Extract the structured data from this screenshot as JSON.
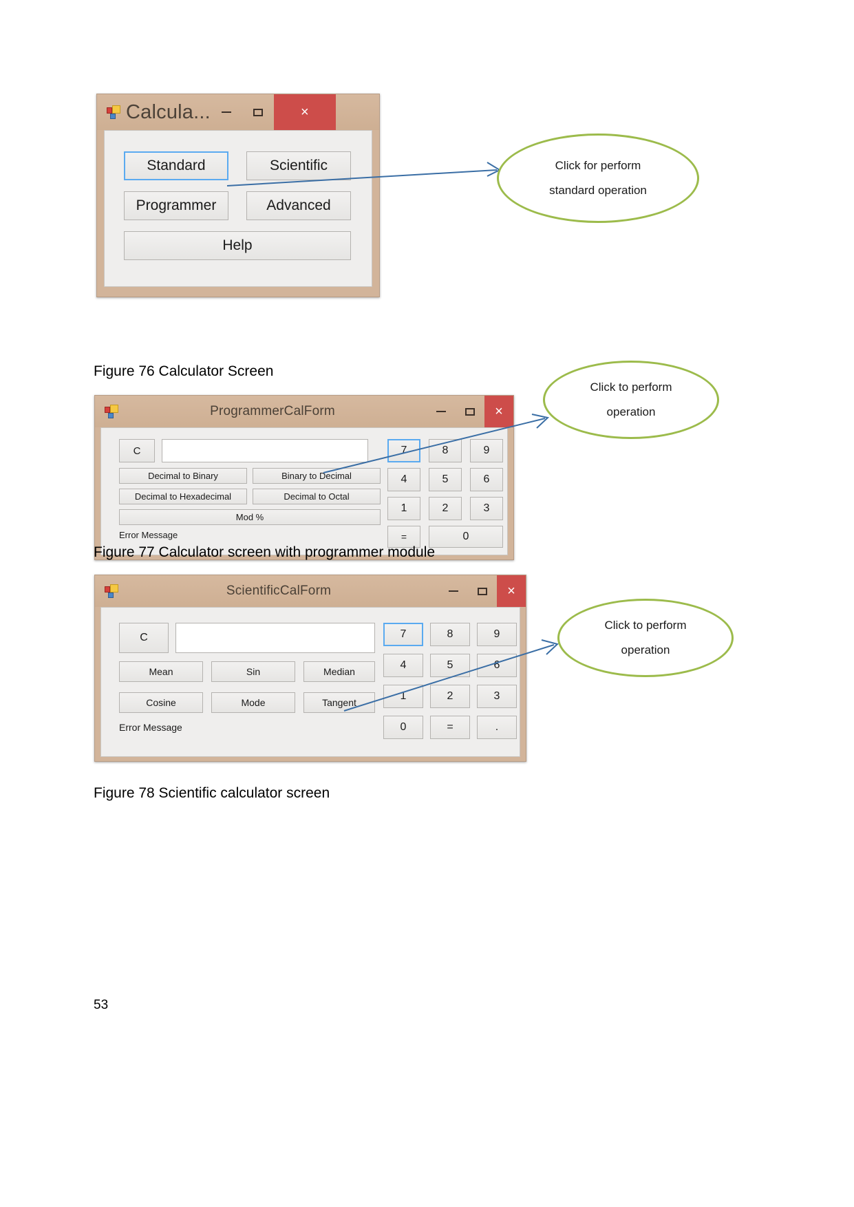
{
  "page": {
    "number": "53",
    "background": "#ffffff"
  },
  "colors": {
    "titlebar": "#d2b49a",
    "close_button": "#cd4d4a",
    "callout_border": "#9cbb4b",
    "arrow": "#3a6ea5",
    "focus_border": "#5aaaf0"
  },
  "figures": [
    {
      "caption": "Figure 76 Calculator Screen"
    },
    {
      "caption": "Figure 77 Calculator screen with programmer module"
    },
    {
      "caption": "Figure 78 Scientific calculator screen"
    }
  ],
  "calculator_window": {
    "title": "Calcula...",
    "icon": "form-icon",
    "controls": {
      "minimize": "minimize-icon",
      "maximize": "maximize-icon",
      "close": "×"
    },
    "buttons": [
      {
        "label": "Standard",
        "focused": true
      },
      {
        "label": "Scientific",
        "focused": false
      },
      {
        "label": "Programmer",
        "focused": false
      },
      {
        "label": "Advanced",
        "focused": false
      },
      {
        "label": "Help",
        "focused": false
      }
    ]
  },
  "programmer_window": {
    "title": "ProgrammerCalForm",
    "icon": "form-icon",
    "controls": {
      "minimize": "minimize-icon",
      "maximize": "maximize-icon",
      "close": "×"
    },
    "clear_button": "C",
    "display_value": "",
    "display_placeholder": "",
    "function_buttons": [
      "Decimal to Binary",
      "Binary to Decimal",
      "Decimal to Hexadecimal",
      "Decimal to Octal"
    ],
    "mod_button": "Mod %",
    "error_label": "Error Message",
    "keypad": [
      {
        "label": "7",
        "focused": true
      },
      {
        "label": "8",
        "focused": false
      },
      {
        "label": "9",
        "focused": false
      },
      {
        "label": "4",
        "focused": false
      },
      {
        "label": "5",
        "focused": false
      },
      {
        "label": "6",
        "focused": false
      },
      {
        "label": "1",
        "focused": false
      },
      {
        "label": "2",
        "focused": false
      },
      {
        "label": "3",
        "focused": false
      },
      {
        "label": "=",
        "focused": false
      },
      {
        "label": "0",
        "focused": false
      }
    ]
  },
  "scientific_window": {
    "title": "ScientificCalForm",
    "icon": "form-icon",
    "controls": {
      "minimize": "minimize-icon",
      "maximize": "maximize-icon",
      "close": "×"
    },
    "clear_button": "C",
    "display_value": "",
    "display_placeholder": "",
    "function_buttons": [
      "Mean",
      "Sin",
      "Median",
      "Cosine",
      "Mode",
      "Tangent"
    ],
    "error_label": "Error Message",
    "keypad": [
      {
        "label": "7",
        "focused": true
      },
      {
        "label": "8",
        "focused": false
      },
      {
        "label": "9",
        "focused": false
      },
      {
        "label": "4",
        "focused": false
      },
      {
        "label": "5",
        "focused": false
      },
      {
        "label": "6",
        "focused": false
      },
      {
        "label": "1",
        "focused": false
      },
      {
        "label": "2",
        "focused": false
      },
      {
        "label": "3",
        "focused": false
      },
      {
        "label": "0",
        "focused": false
      },
      {
        "label": "=",
        "focused": false
      },
      {
        "label": ".",
        "focused": false
      }
    ]
  },
  "callouts": [
    {
      "line1": "Click for perform",
      "line2": "standard operation"
    },
    {
      "line1": "Click to perform",
      "line2": "operation"
    },
    {
      "line1": "Click to perform",
      "line2": "operation"
    }
  ]
}
